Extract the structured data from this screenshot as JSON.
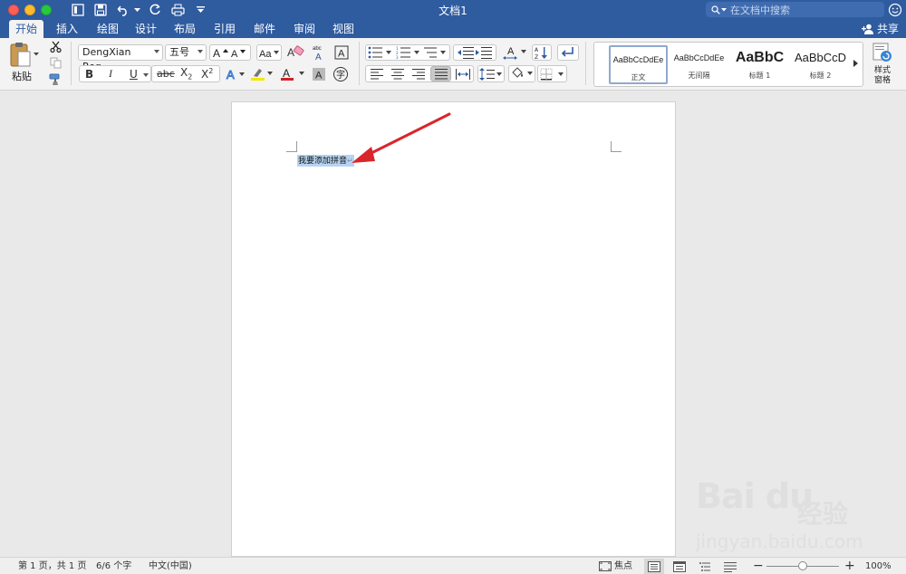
{
  "window": {
    "title": "文档1",
    "search_placeholder": "在文档中搜索"
  },
  "ribbon_tabs": [
    {
      "label": "开始",
      "active": true
    },
    {
      "label": "插入"
    },
    {
      "label": "绘图"
    },
    {
      "label": "设计"
    },
    {
      "label": "布局"
    },
    {
      "label": "引用"
    },
    {
      "label": "邮件"
    },
    {
      "label": "审阅"
    },
    {
      "label": "视图"
    }
  ],
  "share_label": "共享",
  "clipboard": {
    "paste_label": "粘贴"
  },
  "font": {
    "name": "DengXian Reg...",
    "size": "五号",
    "bold": "B",
    "italic": "I",
    "underline": "U",
    "strike": "abc",
    "subscript_base": "X",
    "subscript_mark": "2",
    "superscript_base": "X",
    "superscript_mark": "2",
    "phonetic_label": "abc",
    "border_char": "A",
    "enclose_char": "字"
  },
  "styles": [
    {
      "sample": "AaBbCcDdEe",
      "name": "正文",
      "active": true
    },
    {
      "sample": "AaBbCcDdEe",
      "name": "无间隔"
    },
    {
      "sample": "AaBbC",
      "name": "标题 1"
    },
    {
      "sample": "AaBbCcD",
      "name": "标题 2"
    }
  ],
  "style_pane_label": "样式\n窗格",
  "document": {
    "text": "我要添加拼音",
    "paragraph_mark": "↵"
  },
  "statusbar": {
    "page_info": "第 1 页，共 1 页",
    "word_count": "6/6 个字",
    "language": "中文(中国)",
    "focus_label": "焦点",
    "zoom": "100%"
  },
  "watermark": {
    "brand": "Bai du",
    "cn": "经验",
    "url": "jingyan.baidu.com"
  },
  "colors": {
    "title_bar": "#2f5b9f",
    "highlight": "#b6d4f2",
    "arrow": "#d9262b"
  }
}
